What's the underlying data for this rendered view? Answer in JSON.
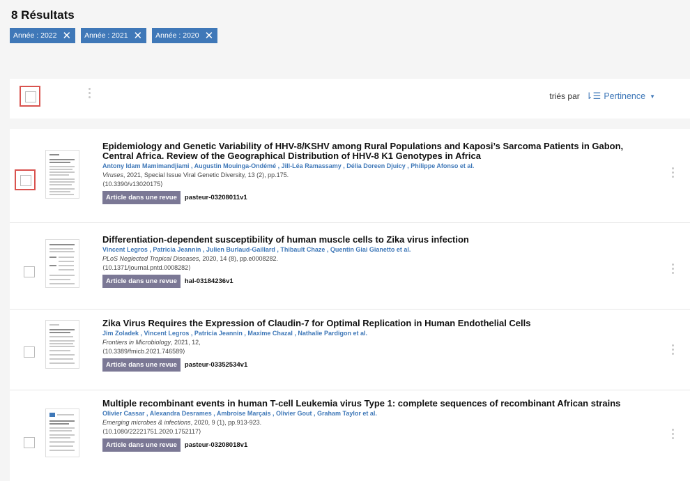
{
  "header": {
    "results_count": "8 Résultats",
    "filters": [
      {
        "label": "Année : 2022"
      },
      {
        "label": "Année : 2021"
      },
      {
        "label": "Année : 2020"
      }
    ]
  },
  "toolbar": {
    "sort_label": "triés par",
    "sort_value": "Pertinence"
  },
  "results": [
    {
      "title": "Epidemiology and Genetic Variability of HHV-8/KSHV among Rural Populations and Kaposi’s Sarcoma Patients in Gabon, Central Africa. Review of the Geographical Distribution of HHV-8 K1 Genotypes in Africa",
      "authors": "Antony Idam Mamimandjiami , Augustin Mouinga-Ondémé , Jill-Léa Ramassamy , Délia Doreen Djuicy , Philippe Afonso et al.",
      "journal": "Viruses",
      "source_rest": ", 2021, Special Issue Viral Genetic Diversity, 13 (2), pp.175.",
      "doi": "⟨10.3390/v13020175⟩",
      "type": "Article dans une revue",
      "hal_id": "pasteur-03208011v1"
    },
    {
      "title": "Differentiation-dependent susceptibility of human muscle cells to Zika virus infection",
      "authors": "Vincent Legros , Patricia Jeannin , Julien Burlaud-Gaillard , Thibault Chaze , Quentin Giai Gianetto et al.",
      "journal": "PLoS Neglected Tropical Diseases",
      "source_rest": ", 2020, 14 (8), pp.e0008282.",
      "doi": "⟨10.1371/journal.pntd.0008282⟩",
      "type": "Article dans une revue",
      "hal_id": "hal-03184236v1"
    },
    {
      "title": "Zika Virus Requires the Expression of Claudin-7 for Optimal Replication in Human Endothelial Cells",
      "authors": "Jim Zoladek , Vincent Legros , Patricia Jeannin , Maxime Chazal , Nathalie Pardigon et al.",
      "journal": "Frontiers in Microbiology",
      "source_rest": ", 2021, 12,",
      "doi": "⟨10.3389/fmicb.2021.746589⟩",
      "type": "Article dans une revue",
      "hal_id": "pasteur-03352534v1"
    },
    {
      "title": "Multiple recombinant events in human T-cell Leukemia virus Type 1: complete sequences of recombinant African strains",
      "authors": "Olivier Cassar , Alexandra Desrames , Ambroise Marçais , Olivier Gout , Graham Taylor et al.",
      "journal": "Emerging microbes & infections",
      "source_rest": ", 2020, 9 (1), pp.913-923.",
      "doi": "⟨10.1080/22221751.2020.1752117⟩",
      "type": "Article dans une revue",
      "hal_id": "pasteur-03208018v1"
    }
  ]
}
